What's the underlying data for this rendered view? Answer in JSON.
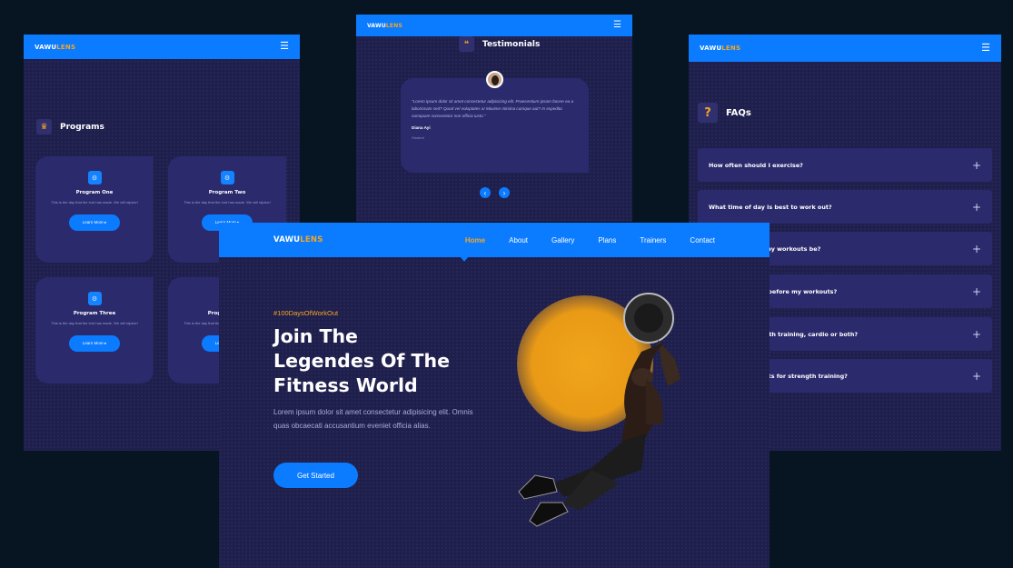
{
  "brand": {
    "part1": "VAWU",
    "part2": "LENS"
  },
  "programs_view": {
    "title": "Programs",
    "cards": [
      {
        "title": "Program One",
        "text": "This is the day that the lord has made. We will rejoice!",
        "button": "Learn More ▸"
      },
      {
        "title": "Program Two",
        "text": "This is the day that the lord has made. We will rejoice!",
        "button": "Learn More ▸"
      },
      {
        "title": "Program Three",
        "text": "This is the day that the lord has made. We will rejoice!",
        "button": "Learn More ▸"
      },
      {
        "title": "Program Four",
        "text": "This is the day that the lord has made. We will rejoice!",
        "button": "Learn More ▸"
      }
    ]
  },
  "testimonials_view": {
    "title": "Testimonials",
    "quote": "\"Lorem ipsum dolor sit amet consectetur adipisicing elit. Praesentium ipsam facere ea a laboriosam sed? Quod vel voluptates a! Maxime minima cumque aut? In expedita numquam consectetur non officia iusto.\"",
    "name": "Diana Ayi",
    "role": "Student"
  },
  "faq_view": {
    "title": "FAQs",
    "items": [
      "How often should I exercise?",
      "What time of day is best to work out?",
      "How long should my workouts be?",
      "Should I warm up before my workouts?",
      "Should I do strength training, cardio or both?",
      "Should I lift weights for strength training?"
    ]
  },
  "hero_view": {
    "nav": [
      "Home",
      "About",
      "Gallery",
      "Plans",
      "Trainers",
      "Contact"
    ],
    "active_nav": "Home",
    "tag": "#100DaysOfWorkOut",
    "heading_lines": [
      "Join The",
      "Legendes Of The",
      "Fitness World"
    ],
    "lead": "Lorem ipsum dolor sit amet consectetur adipisicing elit. Omnis quas obcaecati accusantium eveniet officia alias.",
    "cta": "Get Started"
  },
  "colors": {
    "primary": "#0b7bff",
    "accent": "#f5a623",
    "panel": "#1f1f4c",
    "card": "#2a2a6d",
    "page_bg": "#061521"
  }
}
